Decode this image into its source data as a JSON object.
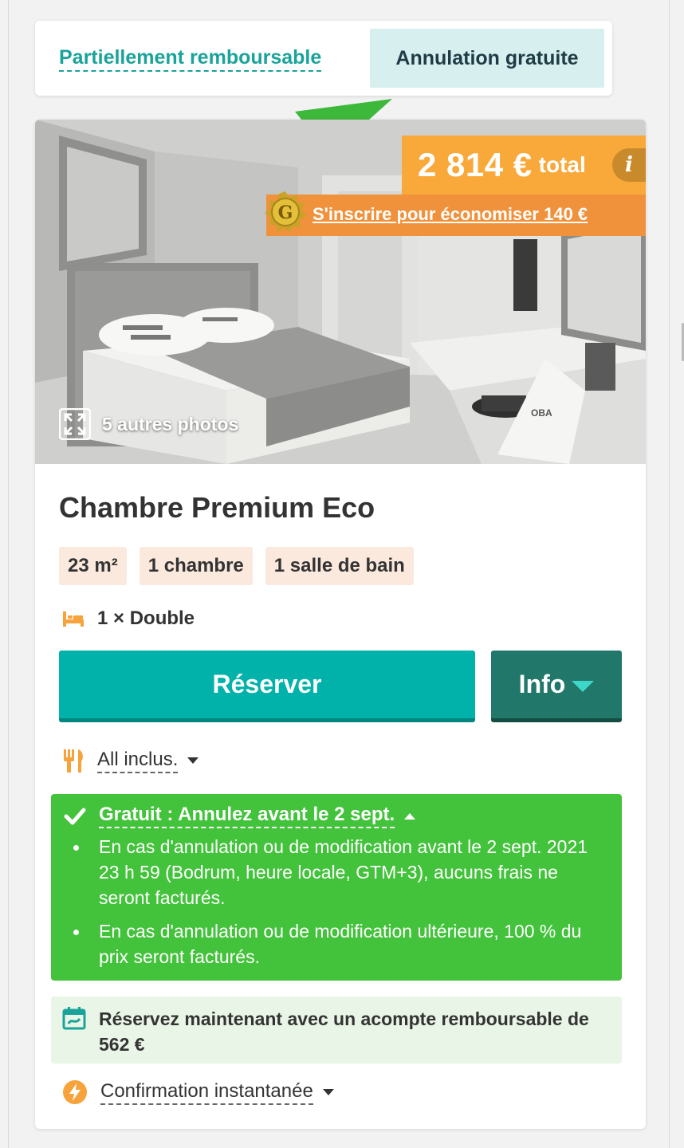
{
  "cancellation_toggle": {
    "partial_label": "Partiellement remboursable",
    "free_label": "Annulation gratuite"
  },
  "room": {
    "price": "2 814 €",
    "price_suffix": "total",
    "info_symbol": "i",
    "promo_badge_letter": "G",
    "promo_text": "S'inscrire pour économiser 140 €",
    "more_photos": "5 autres photos",
    "photo_sign_text": "OBA",
    "title": "Chambre Premium Eco",
    "tags": [
      "23 m²",
      "1 chambre",
      "1 salle de bain"
    ],
    "bed": "1 × Double",
    "reserve_label": "Réserver",
    "info_label": "Info",
    "board": "All inclus.",
    "cancellation": {
      "heading": "Gratuit : Annulez avant le 2 sept.",
      "items": [
        "En cas d'annulation ou de modification avant le 2 sept. 2021 23 h 59 (Bodrum, heure locale, GTM+3), aucuns frais ne seront facturés.",
        "En cas d'annulation ou de modification ultérieure, 100 % du prix seront facturés."
      ]
    },
    "deposit": "Réservez maintenant avec un acompte remboursable de 562 €",
    "confirmation": "Confirmation instantanée"
  },
  "colors": {
    "teal": "#00b2a9",
    "dark_teal": "#20776a",
    "price_orange": "#f9a93a",
    "promo_orange": "#f0913b",
    "cancel_green": "#43c23b",
    "deposit_bg": "#e9f5e6",
    "tag_bg": "#fbe9de",
    "arrow_green": "#3db83a"
  },
  "icons": {
    "bed": "bed-icon",
    "board": "fork-knife-icon",
    "check": "check-icon",
    "deposit": "calendar-icon",
    "confirmation": "lightning-icon",
    "photos": "expand-icon",
    "promo": "gold-badge-icon"
  }
}
